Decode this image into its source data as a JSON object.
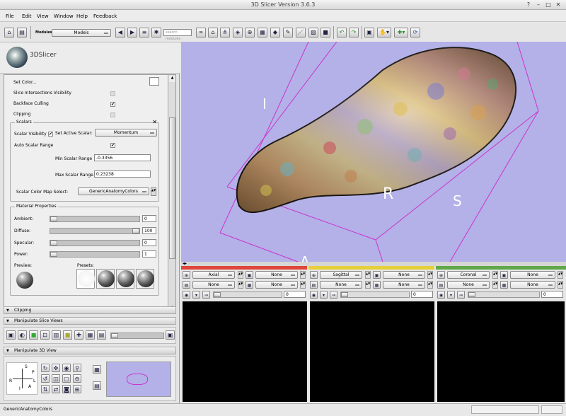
{
  "window": {
    "title": "3D Slicer Version 3.6.3"
  },
  "menu": [
    "File",
    "Edit",
    "View",
    "Window",
    "Help",
    "Feedback"
  ],
  "toolbar": {
    "modules_label": "Modules:",
    "module_selected": "Models",
    "search_placeholder": "search modules"
  },
  "logo": {
    "text": "3DSlicer"
  },
  "panel": {
    "set_color": "Set Color...",
    "slice_intersections": "Slice Intersections Visibility",
    "backface_culling": "Backface Culling",
    "clipping": "Clipping",
    "scalars_title": "Scalars",
    "scalar_visibility": "Scalar Visibility",
    "set_active_scalar": "Set Active Scalar:",
    "active_scalar": "Momentum",
    "auto_scalar_range": "Auto Scalar Range",
    "min_scalar_label": "Min Scalar Range",
    "min_scalar_value": "-0.3356",
    "max_scalar_label": "Max Scalar Range",
    "max_scalar_value": "0.23238",
    "color_map_label": "Scalar Color Map Select:",
    "color_map_value": "GenericAnatomyColors",
    "material_title": "Material Properties",
    "ambient": "Ambient:",
    "ambient_value": "0",
    "diffuse": "Diffuse:",
    "diffuse_value": "100",
    "specular": "Specular:",
    "specular_value": "0",
    "power": "Power:",
    "power_value": "1",
    "preview": "Preview:",
    "presets": "Presets:"
  },
  "sections": {
    "clipping": "Clipping",
    "manipulate_slice": "Manipulate Slice Views",
    "manipulate_3d": "Manipulate 3D View"
  },
  "view3d": {
    "labels": [
      "I",
      "R",
      "S",
      "A"
    ],
    "bg": "#b3b1e8",
    "box_color": "#cc33cc"
  },
  "slices": [
    {
      "name": "Axial",
      "fg": "None",
      "bg": "None",
      "lbl": "None",
      "lbl2": "None",
      "value": "0",
      "color": "#e0453c"
    },
    {
      "name": "Sagittal",
      "fg": "None",
      "bg": "None",
      "lbl": "None",
      "lbl2": "None",
      "value": "0",
      "color": "#e6cf3a"
    },
    {
      "name": "Coronal",
      "fg": "None",
      "bg": "None",
      "lbl": "None",
      "lbl2": "None",
      "value": "0",
      "color": "#5fa84a"
    }
  ],
  "orient": {
    "S": "S",
    "P": "P",
    "R": "R",
    "L": "L",
    "I": "I",
    "A": "A"
  },
  "status": {
    "text": "GenericAnatomyColors"
  }
}
